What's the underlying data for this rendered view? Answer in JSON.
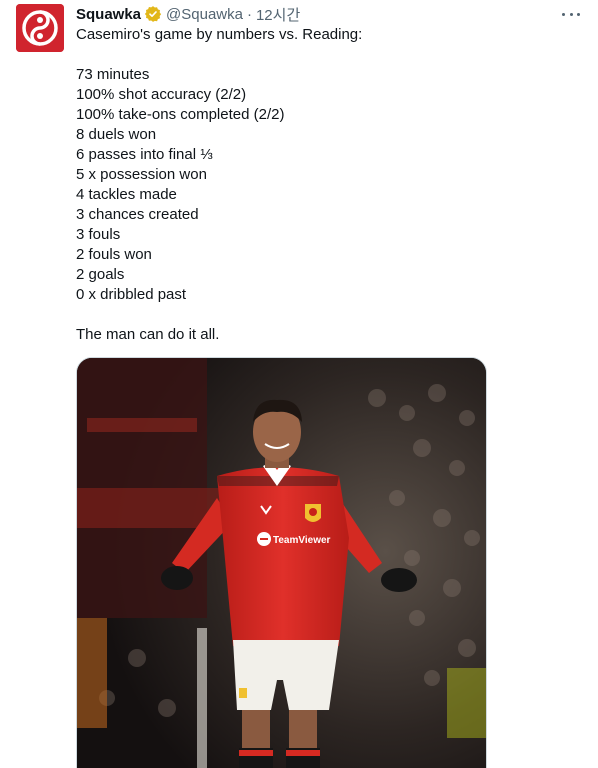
{
  "tweet": {
    "display_name": "Squawka",
    "handle": "@Squawka",
    "separator": "·",
    "time": "12시간",
    "verified_icon": "verified-badge-icon",
    "more_icon": "more-options-icon",
    "lines": [
      "Casemiro's game by numbers vs. Reading:",
      "",
      "73 minutes",
      "100% shot accuracy (2/2)",
      "100% take-ons completed (2/2)",
      "8 duels won",
      "6 passes into final ⅓",
      "5 x possession won",
      "4 tackles made",
      "3 chances created",
      "3 fouls",
      "2 fouls won",
      "2 goals",
      "0 x dribbled past",
      "",
      "The man can do it all."
    ],
    "sponsor_text": "TeamViewer"
  },
  "colors": {
    "brand_red": "#d0242e",
    "verified_gold": "#e2b719",
    "text_primary": "#0f1419",
    "text_secondary": "#536471",
    "kit_red": "#da291c"
  }
}
